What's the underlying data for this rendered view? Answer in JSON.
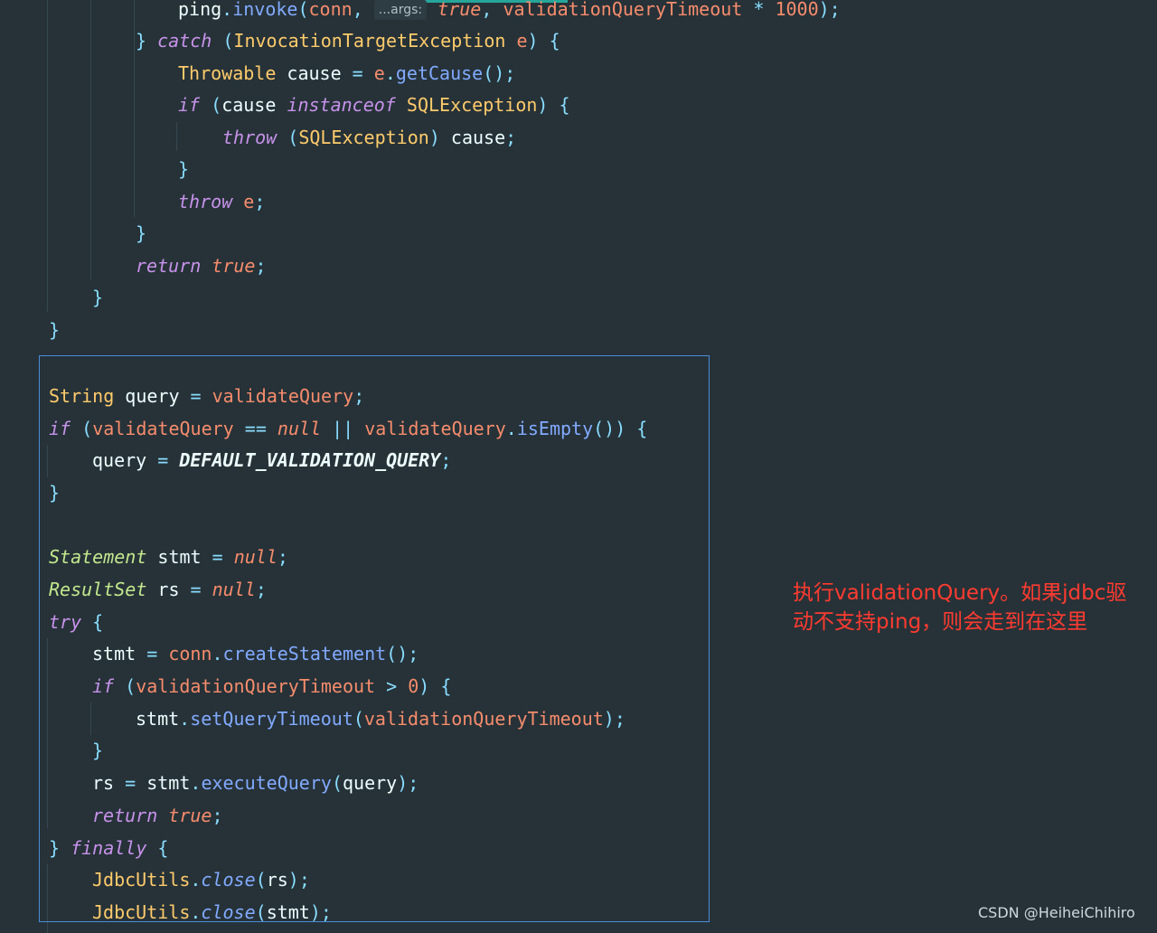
{
  "editor": {
    "background": "#263238",
    "inline_hint": "...args:",
    "lines": [
      {
        "id": "l1",
        "parts": [
          [
            "id",
            "ping"
          ],
          [
            "pn",
            "."
          ],
          [
            "fn",
            "invoke"
          ],
          [
            "pn",
            "("
          ],
          [
            "fld",
            "conn"
          ],
          [
            "pn",
            ", "
          ],
          [
            "hint",
            "...args:"
          ],
          [
            "pn",
            " "
          ],
          [
            "lit",
            "true"
          ],
          [
            "pn",
            ", "
          ],
          [
            "fld",
            "validationQueryTimeout"
          ],
          [
            "op",
            " * "
          ],
          [
            "num",
            "1000"
          ],
          [
            "pn",
            ");"
          ]
        ]
      },
      {
        "id": "l2",
        "parts": [
          [
            "pn",
            "} "
          ],
          [
            "kw",
            "catch"
          ],
          [
            "pn",
            " ("
          ],
          [
            "cls",
            "InvocationTargetException"
          ],
          [
            "id",
            " "
          ],
          [
            "fld",
            "e"
          ],
          [
            "pn",
            ") {"
          ]
        ]
      },
      {
        "id": "l3",
        "parts": [
          [
            "cls",
            "Throwable"
          ],
          [
            "id",
            " cause "
          ],
          [
            "op",
            "="
          ],
          [
            "id",
            " "
          ],
          [
            "fld",
            "e"
          ],
          [
            "pn",
            "."
          ],
          [
            "fn",
            "getCause"
          ],
          [
            "pn",
            "();"
          ]
        ]
      },
      {
        "id": "l4",
        "parts": [
          [
            "kw",
            "if"
          ],
          [
            "pn",
            " ("
          ],
          [
            "id",
            "cause "
          ],
          [
            "kw",
            "instanceof"
          ],
          [
            "id",
            " "
          ],
          [
            "cls",
            "SQLException"
          ],
          [
            "pn",
            ") {"
          ]
        ]
      },
      {
        "id": "l5",
        "parts": [
          [
            "kw",
            "throw"
          ],
          [
            "pn",
            " ("
          ],
          [
            "cls",
            "SQLException"
          ],
          [
            "pn",
            ")"
          ],
          [
            "id",
            " cause"
          ],
          [
            "pn",
            ";"
          ]
        ]
      },
      {
        "id": "l6",
        "parts": [
          [
            "pn",
            "}"
          ]
        ]
      },
      {
        "id": "l7",
        "parts": [
          [
            "kw",
            "throw"
          ],
          [
            "id",
            " "
          ],
          [
            "fld",
            "e"
          ],
          [
            "pn",
            ";"
          ]
        ]
      },
      {
        "id": "l8",
        "parts": [
          [
            "pn",
            "}"
          ]
        ]
      },
      {
        "id": "l9",
        "parts": [
          [
            "kw",
            "return"
          ],
          [
            "id",
            " "
          ],
          [
            "lit",
            "true"
          ],
          [
            "pn",
            ";"
          ]
        ]
      },
      {
        "id": "l10",
        "parts": [
          [
            "pn",
            "}"
          ]
        ]
      },
      {
        "id": "l11",
        "parts": [
          [
            "pn",
            "}"
          ]
        ]
      },
      {
        "id": "l12",
        "parts": [
          [
            "cls",
            "String"
          ],
          [
            "id",
            " query "
          ],
          [
            "op",
            "="
          ],
          [
            "id",
            " "
          ],
          [
            "fld",
            "validateQuery"
          ],
          [
            "pn",
            ";"
          ]
        ]
      },
      {
        "id": "l13",
        "parts": [
          [
            "kw",
            "if"
          ],
          [
            "pn",
            " ("
          ],
          [
            "fld",
            "validateQuery"
          ],
          [
            "op",
            " == "
          ],
          [
            "lit",
            "null"
          ],
          [
            "op",
            " || "
          ],
          [
            "fld",
            "validateQuery"
          ],
          [
            "pn",
            "."
          ],
          [
            "fn",
            "isEmpty"
          ],
          [
            "pn",
            "()) {"
          ]
        ]
      },
      {
        "id": "l14",
        "parts": [
          [
            "id",
            "query "
          ],
          [
            "op",
            "="
          ],
          [
            "id",
            " "
          ],
          [
            "const",
            "DEFAULT_VALIDATION_QUERY"
          ],
          [
            "pn",
            ";"
          ]
        ]
      },
      {
        "id": "l15",
        "parts": [
          [
            "pn",
            "}"
          ]
        ]
      },
      {
        "id": "l16",
        "parts": [
          [
            "cls-it",
            "Statement"
          ],
          [
            "id",
            " stmt "
          ],
          [
            "op",
            "="
          ],
          [
            "id",
            " "
          ],
          [
            "lit",
            "null"
          ],
          [
            "pn",
            ";"
          ]
        ]
      },
      {
        "id": "l17",
        "parts": [
          [
            "cls-it",
            "ResultSet"
          ],
          [
            "id",
            " rs "
          ],
          [
            "op",
            "="
          ],
          [
            "id",
            " "
          ],
          [
            "lit",
            "null"
          ],
          [
            "pn",
            ";"
          ]
        ]
      },
      {
        "id": "l18",
        "parts": [
          [
            "kw",
            "try"
          ],
          [
            "pn",
            " {"
          ]
        ]
      },
      {
        "id": "l19",
        "parts": [
          [
            "id",
            "stmt "
          ],
          [
            "op",
            "="
          ],
          [
            "id",
            " "
          ],
          [
            "fld",
            "conn"
          ],
          [
            "pn",
            "."
          ],
          [
            "fn",
            "createStatement"
          ],
          [
            "pn",
            "();"
          ]
        ]
      },
      {
        "id": "l20",
        "parts": [
          [
            "kw",
            "if"
          ],
          [
            "pn",
            " ("
          ],
          [
            "fld",
            "validationQueryTimeout"
          ],
          [
            "op",
            " > "
          ],
          [
            "num",
            "0"
          ],
          [
            "pn",
            ") {"
          ]
        ]
      },
      {
        "id": "l21",
        "parts": [
          [
            "id",
            "stmt"
          ],
          [
            "pn",
            "."
          ],
          [
            "fn",
            "setQueryTimeout"
          ],
          [
            "pn",
            "("
          ],
          [
            "fld",
            "validationQueryTimeout"
          ],
          [
            "pn",
            ");"
          ]
        ]
      },
      {
        "id": "l22",
        "parts": [
          [
            "pn",
            "}"
          ]
        ]
      },
      {
        "id": "l23",
        "parts": [
          [
            "id",
            "rs "
          ],
          [
            "op",
            "="
          ],
          [
            "id",
            " stmt"
          ],
          [
            "pn",
            "."
          ],
          [
            "fn",
            "executeQuery"
          ],
          [
            "pn",
            "("
          ],
          [
            "id",
            "query"
          ],
          [
            "pn",
            ");"
          ]
        ]
      },
      {
        "id": "l24",
        "parts": [
          [
            "kw",
            "return"
          ],
          [
            "id",
            " "
          ],
          [
            "lit",
            "true"
          ],
          [
            "pn",
            ";"
          ]
        ]
      },
      {
        "id": "l25",
        "parts": [
          [
            "pn",
            "} "
          ],
          [
            "kw",
            "finally"
          ],
          [
            "pn",
            " {"
          ]
        ]
      },
      {
        "id": "l26",
        "parts": [
          [
            "cls",
            "JdbcUtils"
          ],
          [
            "pn",
            "."
          ],
          [
            "fn-it",
            "close"
          ],
          [
            "pn",
            "("
          ],
          [
            "id",
            "rs"
          ],
          [
            "pn",
            ");"
          ]
        ]
      },
      {
        "id": "l27",
        "parts": [
          [
            "cls",
            "JdbcUtils"
          ],
          [
            "pn",
            "."
          ],
          [
            "fn-it",
            "close"
          ],
          [
            "pn",
            "("
          ],
          [
            "id",
            "stmt"
          ],
          [
            "pn",
            ");"
          ]
        ]
      }
    ]
  },
  "annotation": {
    "text": "执行validationQuery。如果jdbc驱动不支持ping，则会走到在这里",
    "color": "#ff3b30"
  },
  "watermark": {
    "text": "CSDN @HeiheiChihiro"
  },
  "colors": {
    "keyword": "#c792ea",
    "class": "#ffcb6b",
    "function": "#82aaff",
    "literal": "#f78c6c",
    "box": "#4a8dd9"
  }
}
